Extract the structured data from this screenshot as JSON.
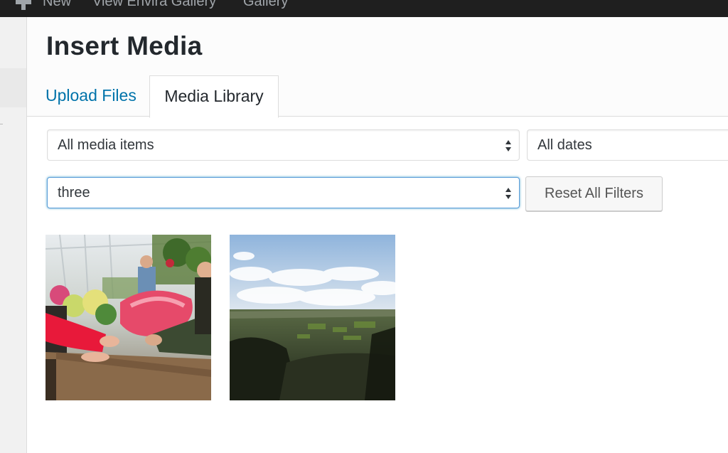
{
  "admin_bar": {
    "new_label": "New",
    "view_gallery_label": "View Envira Gallery",
    "gallery_label": "Gallery"
  },
  "modal": {
    "title": "Insert Media",
    "tabs": [
      {
        "label": "Upload Files",
        "active": false
      },
      {
        "label": "Media Library",
        "active": true
      }
    ]
  },
  "filters": {
    "media_type": {
      "selected": "All media items"
    },
    "dates": {
      "selected": "All dates"
    },
    "album": {
      "selected": "three"
    },
    "reset_label": "Reset All Filters"
  },
  "attachments": [
    {
      "icon": "flower-shop-photo"
    },
    {
      "icon": "landscape-photo"
    }
  ],
  "colors": {
    "link": "#0073aa",
    "focus": "#5b9dd9",
    "admin_bar": "#1f1f1f"
  }
}
